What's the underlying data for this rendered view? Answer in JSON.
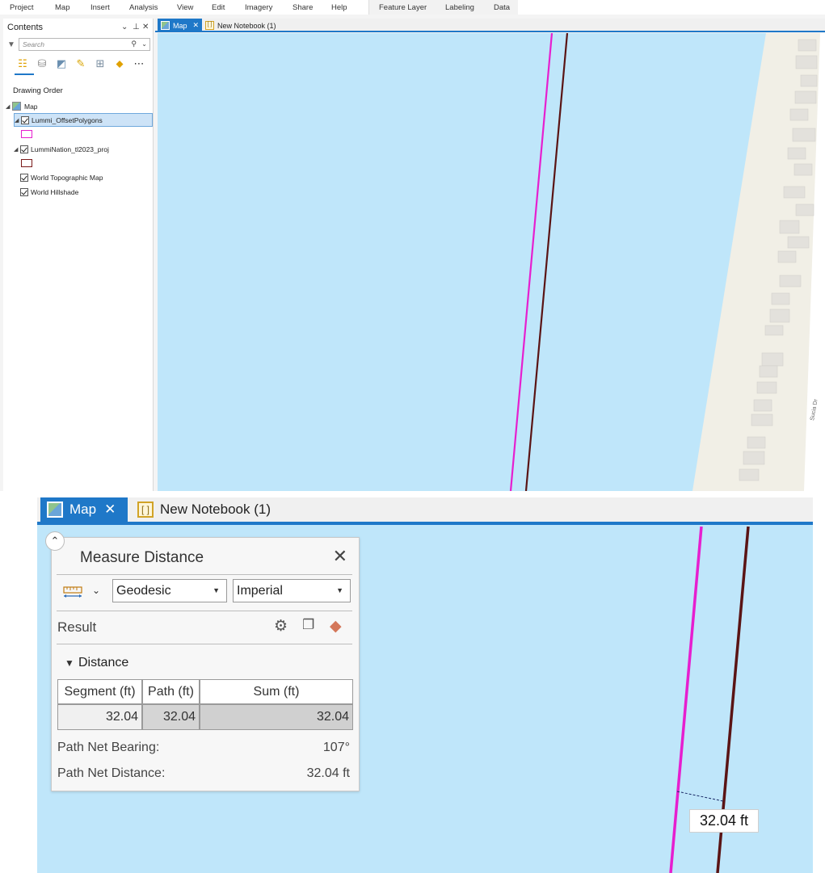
{
  "menu": {
    "items": [
      "Project",
      "Map",
      "Insert",
      "Analysis",
      "View",
      "Edit",
      "Imagery",
      "Share",
      "Help"
    ],
    "context_items": [
      "Feature Layer",
      "Labeling",
      "Data"
    ]
  },
  "contents": {
    "title": "Contents",
    "search_placeholder": "Search",
    "section": "Drawing Order",
    "layers": [
      {
        "label": "Map"
      },
      {
        "label": "Lummi_OffsetPolygons",
        "color": "#e61fcf"
      },
      {
        "label": "LummiNation_tl2023_proj",
        "color": "#7a1a1a"
      },
      {
        "label": "World Topographic Map"
      },
      {
        "label": "World Hillshade"
      }
    ]
  },
  "tabs": {
    "map": "Map",
    "notebook": "New Notebook (1)"
  },
  "map": {
    "water_color": "#bfe6fa",
    "land_color": "#f1efe6",
    "street_label": "Sucia Dr"
  },
  "measure": {
    "title": "Measure Distance",
    "mode": "Geodesic",
    "units": "Imperial",
    "result_label": "Result",
    "distance_label": "Distance",
    "table": {
      "headers": [
        "Segment (ft)",
        "Path (ft)",
        "Sum (ft)"
      ],
      "values": [
        "32.04",
        "32.04",
        "32.04"
      ]
    },
    "bearing_label": "Path Net Bearing:",
    "bearing_value": "107°",
    "net_distance_label": "Path Net Distance:",
    "net_distance_value": "32.04 ft",
    "map_label": "32.04 ft"
  },
  "icons": {
    "collapse": "chevron-up-icon",
    "close": "close-icon",
    "ruler": "ruler-icon",
    "settings": "gear-icon",
    "copy": "copy-icon",
    "eraser": "eraser-icon"
  }
}
